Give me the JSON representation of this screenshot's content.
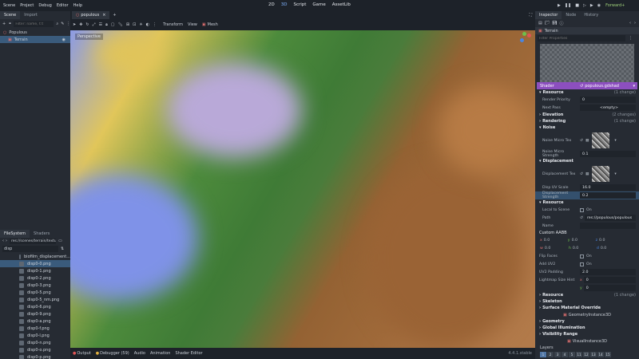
{
  "menu": [
    "Scene",
    "Project",
    "Debug",
    "Editor",
    "Help"
  ],
  "workspaces": [
    {
      "label": "2D",
      "active": false
    },
    {
      "label": "3D",
      "active": true
    },
    {
      "label": "Script",
      "active": false
    },
    {
      "label": "Game",
      "active": false
    },
    {
      "label": "AssetLib",
      "active": false
    }
  ],
  "renderer": "Forward+",
  "scene_dock": {
    "tabs": [
      "Scene",
      "Import"
    ],
    "filter_placeholder": "Filter: name, t:t",
    "tree": [
      {
        "label": "Populous",
        "selected": false
      },
      {
        "label": "Terrain",
        "selected": true
      }
    ]
  },
  "filesystem": {
    "tabs": [
      "FileSystem",
      "Shaders"
    ],
    "path": "res://scenes/terrain/textur",
    "filter": "disp",
    "files": [
      {
        "name": "biofilm_displacement...",
        "selected": false
      },
      {
        "name": "disp0-0.png",
        "selected": true
      },
      {
        "name": "disp0-1.png",
        "selected": false
      },
      {
        "name": "disp0-2.png",
        "selected": false
      },
      {
        "name": "disp0-3.png",
        "selected": false
      },
      {
        "name": "disp0-5.png",
        "selected": false
      },
      {
        "name": "disp0-5_nm.png",
        "selected": false
      },
      {
        "name": "disp0-6.png",
        "selected": false
      },
      {
        "name": "disp0-9.png",
        "selected": false
      },
      {
        "name": "disp0-a.png",
        "selected": false
      },
      {
        "name": "disp0-f.png",
        "selected": false
      },
      {
        "name": "disp0-l.png",
        "selected": false
      },
      {
        "name": "disp0-n.png",
        "selected": false
      },
      {
        "name": "disp0-o.png",
        "selected": false
      },
      {
        "name": "disp0-p.png",
        "selected": false
      }
    ]
  },
  "editor_tabs": [
    {
      "label": "populous",
      "active": true
    }
  ],
  "viewport_toolbar": {
    "transform": "Transform",
    "view": "View",
    "mesh": "Mesh"
  },
  "viewport_label": "Perspective",
  "bottom_tabs": [
    "Output",
    "Debugger (59)",
    "Audio",
    "Animation",
    "Shader Editor"
  ],
  "version": "4.4.1.stable",
  "inspector": {
    "tabs": [
      "Inspector",
      "Node",
      "History"
    ],
    "node_name": "Terrain",
    "filter_placeholder": "Filter Properties",
    "shader_label": "Shader",
    "shader_file": "populous.gdshad",
    "sections": {
      "resource": "Resource",
      "elevation": "Elevation",
      "rendering": "Rendering",
      "noise": "Noise",
      "displacement": "Displacement",
      "resource2": "Resource",
      "custom_aabb": "Custom AABB",
      "resource3": "Resource",
      "skeleton": "Skeleton",
      "surface_override": "Surface Material Override",
      "geometry": "Geometry",
      "gi": "Global Illumination",
      "visibility": "Visibility Range",
      "layers": "Layers"
    },
    "changes": {
      "resource": "(1 change)",
      "elevation": "(2 changes)",
      "rendering": "(1 change)",
      "resource3": "(1 change)"
    },
    "props": {
      "render_priority": {
        "k": "Render Priority",
        "v": "0"
      },
      "next_pass": {
        "k": "Next Pass",
        "v": "<empty>"
      },
      "noise_micro_tex": {
        "k": "Noise Micro Tex"
      },
      "noise_micro_strength": {
        "k": "Noise Micro Strength",
        "v": "0.1"
      },
      "displacement_tex": {
        "k": "Displacement Tex"
      },
      "disp_uv_scale": {
        "k": "Disp UV Scale",
        "v": "16.0"
      },
      "displacement_strength": {
        "k": "Displacement Strength",
        "v": "0.2"
      },
      "local_to_scene": {
        "k": "Local to Scene",
        "v": "On"
      },
      "path": {
        "k": "Path",
        "v": "res://populous/populous"
      },
      "name": {
        "k": "Name",
        "v": ""
      },
      "flip_faces": {
        "k": "Flip Faces",
        "v": "On"
      },
      "add_uv2": {
        "k": "Add UV2",
        "v": "On"
      },
      "uv2_padding": {
        "k": "UV2 Padding",
        "v": "2.0"
      },
      "lightmap_size_hint": {
        "k": "Lightmap Size Hint",
        "vx": "0",
        "vy": "0"
      }
    },
    "aabb": {
      "x": "0.0",
      "y": "0.0",
      "z": "0.0",
      "w": "0.0",
      "h": "0.0",
      "d": "0.0"
    },
    "geometry_instance": "GeometryInstance3D",
    "visual_instance": "VisualInstance3D",
    "layers": [
      "1",
      "2",
      "3",
      "4",
      "5",
      "11",
      "12",
      "13",
      "14",
      "15"
    ]
  },
  "colors": {
    "accent": "#7fb3ff",
    "selection": "#3a5b7c",
    "shader_header": "#8c4fbf"
  }
}
